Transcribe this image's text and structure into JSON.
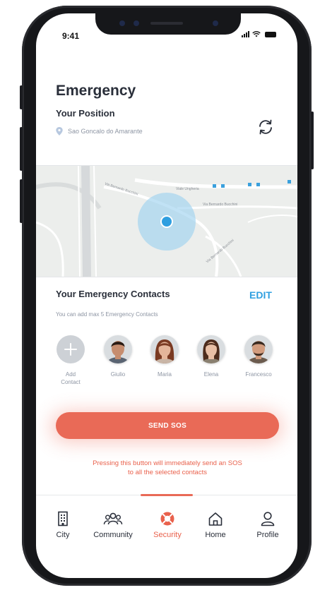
{
  "status_bar": {
    "time": "9:41"
  },
  "header": {
    "title": "Emergency",
    "position_label": "Your Position",
    "location": "Sao Goncalo do Amarante"
  },
  "map": {
    "streets": [
      "Via Bernardo Bucchini",
      "Viale Ungheria",
      "Via Bernardo Bucchini",
      "Via Bernardo Bucchini"
    ],
    "accent": "#3aa0dd"
  },
  "contacts": {
    "title": "Your Emergency Contacts",
    "edit_label": "EDIT",
    "hint": "You can add max 5 Emergency Contacts",
    "add_label": "Add Contact",
    "items": [
      {
        "name": "Giulio",
        "skin": "#c68d6f",
        "hair": "#2a1b14",
        "shirt": "#5a6472"
      },
      {
        "name": "Maria",
        "skin": "#e4b59a",
        "hair": "#7a3a22",
        "shirt": "#c9b5a6"
      },
      {
        "name": "Elena",
        "skin": "#e8bfa5",
        "hair": "#4d2c1c",
        "shirt": "#8a8070"
      },
      {
        "name": "Francesco",
        "skin": "#d29c7e",
        "hair": "#3a2a20",
        "shirt": "#6b5b4e"
      }
    ]
  },
  "sos": {
    "button_label": "SEND SOS",
    "note_line1": "Pressing this button will immediately send an SOS",
    "note_line2": "to all the selected contacts",
    "color": "#e96a57"
  },
  "tabs": [
    {
      "label": "City",
      "icon": "building-icon"
    },
    {
      "label": "Community",
      "icon": "group-icon"
    },
    {
      "label": "Security",
      "icon": "lifebuoy-icon",
      "active": true
    },
    {
      "label": "Home",
      "icon": "house-icon"
    },
    {
      "label": "Profile",
      "icon": "user-icon"
    }
  ]
}
